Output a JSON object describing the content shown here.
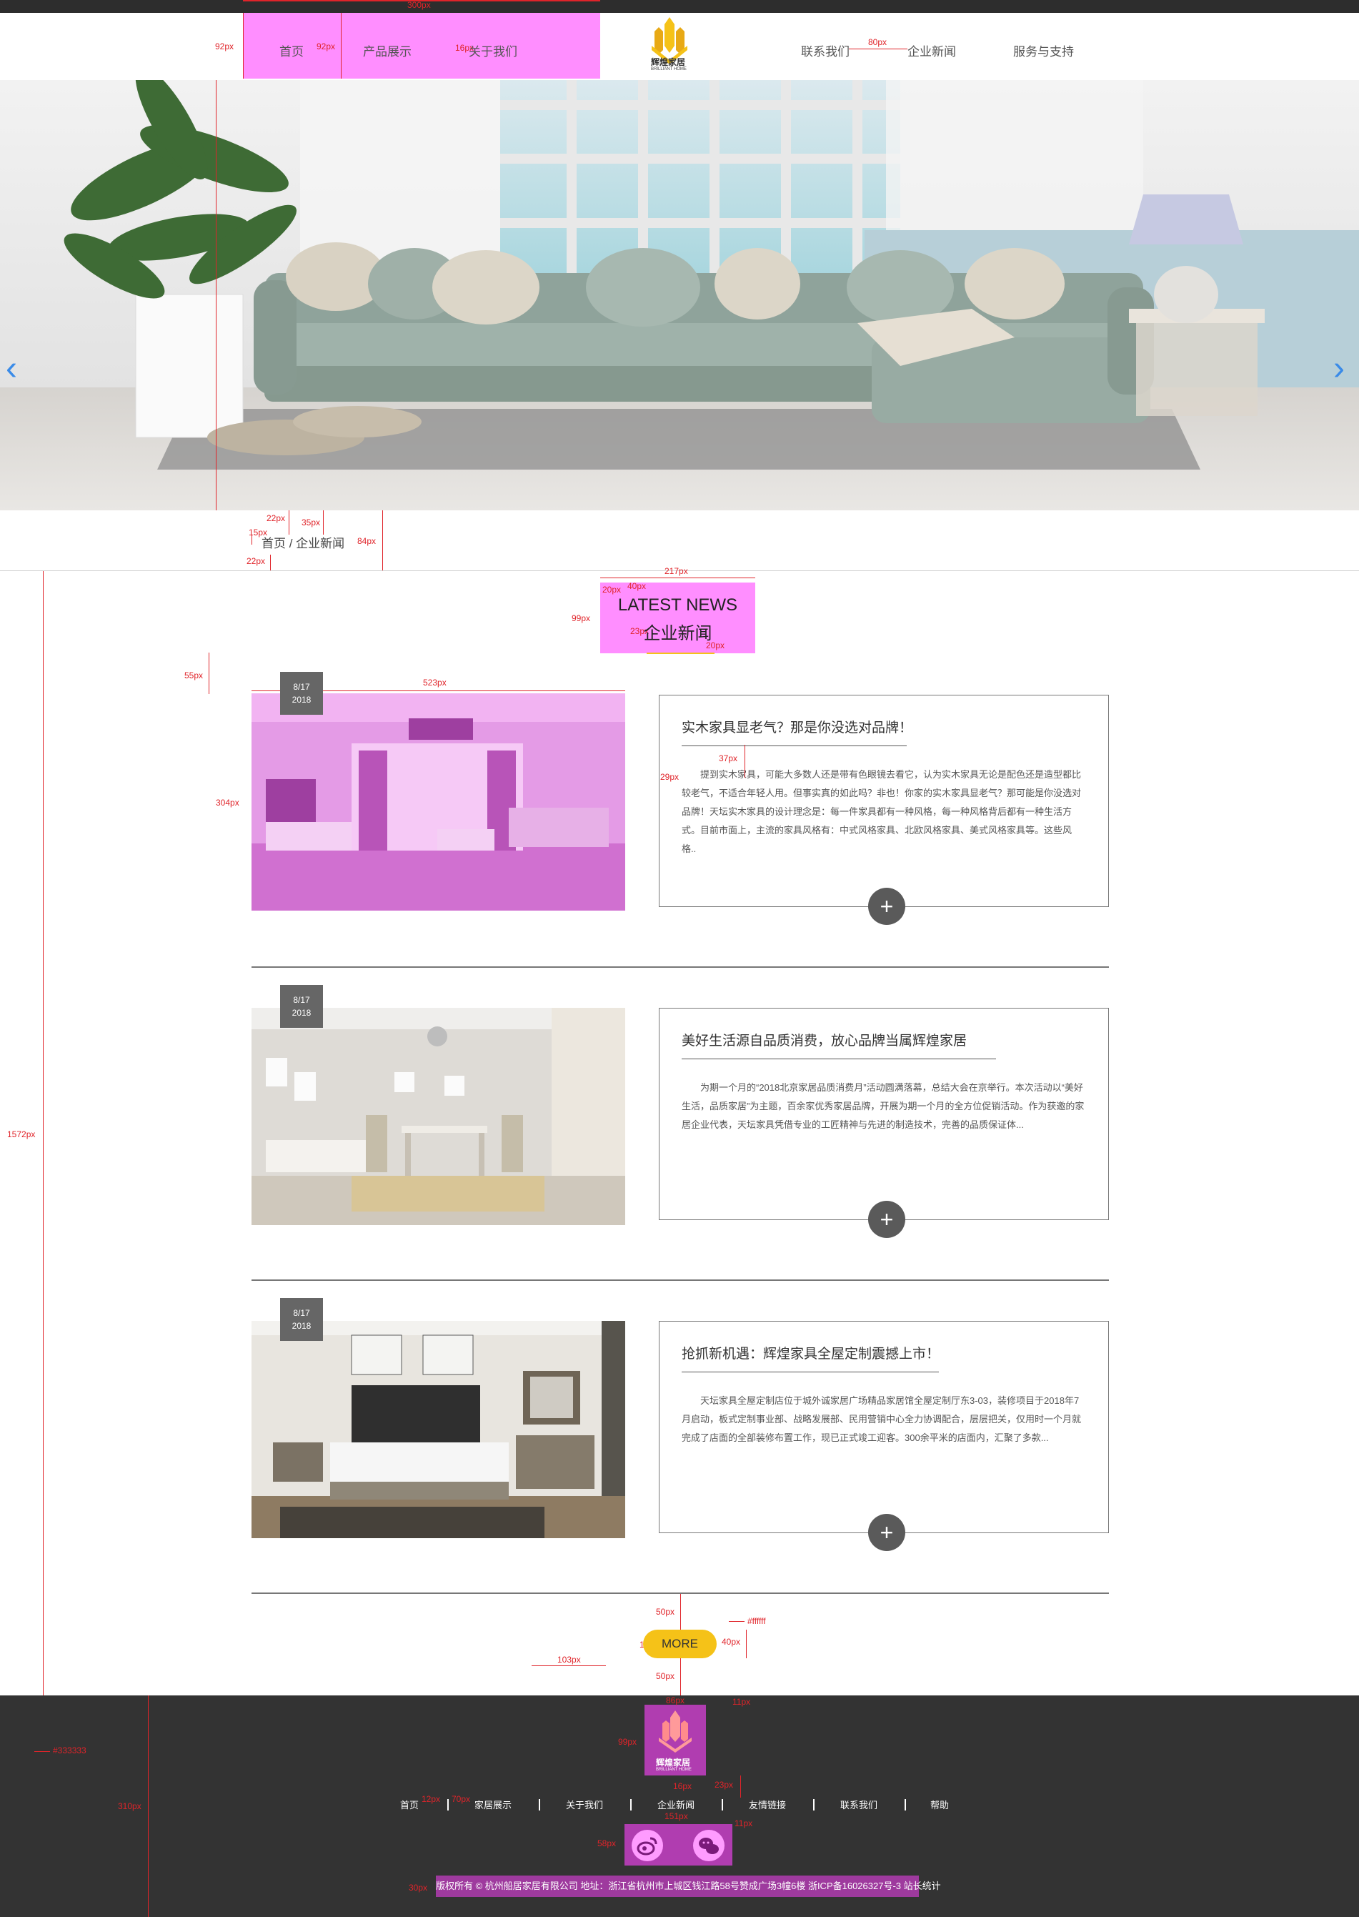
{
  "top_measure": "300px",
  "header": {
    "nav_left": [
      "首页",
      "产品展示",
      "关于我们"
    ],
    "nav_right": [
      "联系我们",
      "企业新闻",
      "服务与支持"
    ],
    "logo_text": "辉煌家居",
    "logo_sub": "BRILLIANT HOME"
  },
  "measurements": {
    "m92a": "92px",
    "m92b": "92px",
    "m16": "16px",
    "m80": "80px",
    "m22a": "22px",
    "m35": "35px",
    "m15": "15px",
    "m84": "84px",
    "m22b": "22px",
    "m1572": "1572px",
    "m217": "217px",
    "m20a": "20px",
    "m40": "40px",
    "m99": "99px",
    "m23": "23px",
    "m20b": "20px",
    "m55": "55px",
    "m523": "523px",
    "m304": "304px",
    "m37": "37px",
    "m29": "29px",
    "m50a": "50px",
    "m50b": "50px",
    "m14": "14px",
    "m40b": "40px",
    "m103": "103px",
    "m_ffffff": "#ffffff",
    "m_333": "#333333",
    "m310": "310px",
    "m99b": "99px",
    "m86": "86px",
    "m11": "11px",
    "m23b": "23px",
    "m16b": "16px",
    "m151": "151px",
    "m11b": "11px",
    "m58": "58px",
    "m30": "30px",
    "m12": "12px",
    "m70": "70px"
  },
  "banner": {
    "arrow_left": "‹",
    "arrow_right": "›"
  },
  "breadcrumb": "首页 / 企业新闻",
  "section_title": {
    "en": "LATEST NEWS",
    "cn": "企业新闻"
  },
  "news": [
    {
      "date_md": "8/17",
      "date_y": "2018",
      "title": "实木家具显老气？那是你没选对品牌！",
      "body": "提到实木家具，可能大多数人还是带有色眼镜去看它，认为实木家具无论是配色还是造型都比较老气，不适合年轻人用。但事实真的如此吗？非也！你家的实木家具显老气？那可能是你没选对品牌！天坛实木家具的设计理念是：每一件家具都有一种风格，每一种风格背后都有一种生活方式。目前市面上，主流的家具风格有：中式风格家具、北欧风格家具、美式风格家具等。这些风格..",
      "plus": "+"
    },
    {
      "date_md": "8/17",
      "date_y": "2018",
      "title": "美好生活源自品质消费，放心品牌当属辉煌家居",
      "body": "为期一个月的“2018北京家居品质消费月”活动圆满落幕，总结大会在京举行。本次活动以“美好生活，品质家居”为主题，百余家优秀家居品牌，开展为期一个月的全方位促销活动。作为获邀的家居企业代表，天坛家具凭借专业的工匠精神与先进的制造技术，完善的品质保证体...",
      "plus": "+"
    },
    {
      "date_md": "8/17",
      "date_y": "2018",
      "title": "抢抓新机遇：辉煌家具全屋定制震撼上市！",
      "body": "天坛家具全屋定制店位于城外诚家居广场精品家居馆全屋定制厅东3-03，装修项目于2018年7月启动，板式定制事业部、战略发展部、民用营销中心全力协调配合，层层把关，仅用时一个月就完成了店面的全部装修布置工作，现已正式竣工迎客。300余平米的店面内，汇聚了多款...",
      "plus": "+"
    }
  ],
  "more_label": "MORE",
  "footer": {
    "logo_text": "辉煌家居",
    "logo_sub": "BRILLIANT HOME",
    "nav": [
      "首页",
      "家居展示",
      "关于我们",
      "企业新闻",
      "友情链接",
      "联系我们",
      "帮助"
    ],
    "copyright": "版权所有 © 杭州船居家居有限公司 地址：浙江省杭州市上城区钱江路58号赞成广场3幢6楼 浙ICP备16026327号-3 站长统计"
  },
  "colors": {
    "accent_yellow": "#f5c218",
    "footer_bg": "#333333",
    "highlight_magenta": "#ff6eff",
    "measure_red": "#e0242a",
    "arrow_blue": "#3a8be8"
  }
}
